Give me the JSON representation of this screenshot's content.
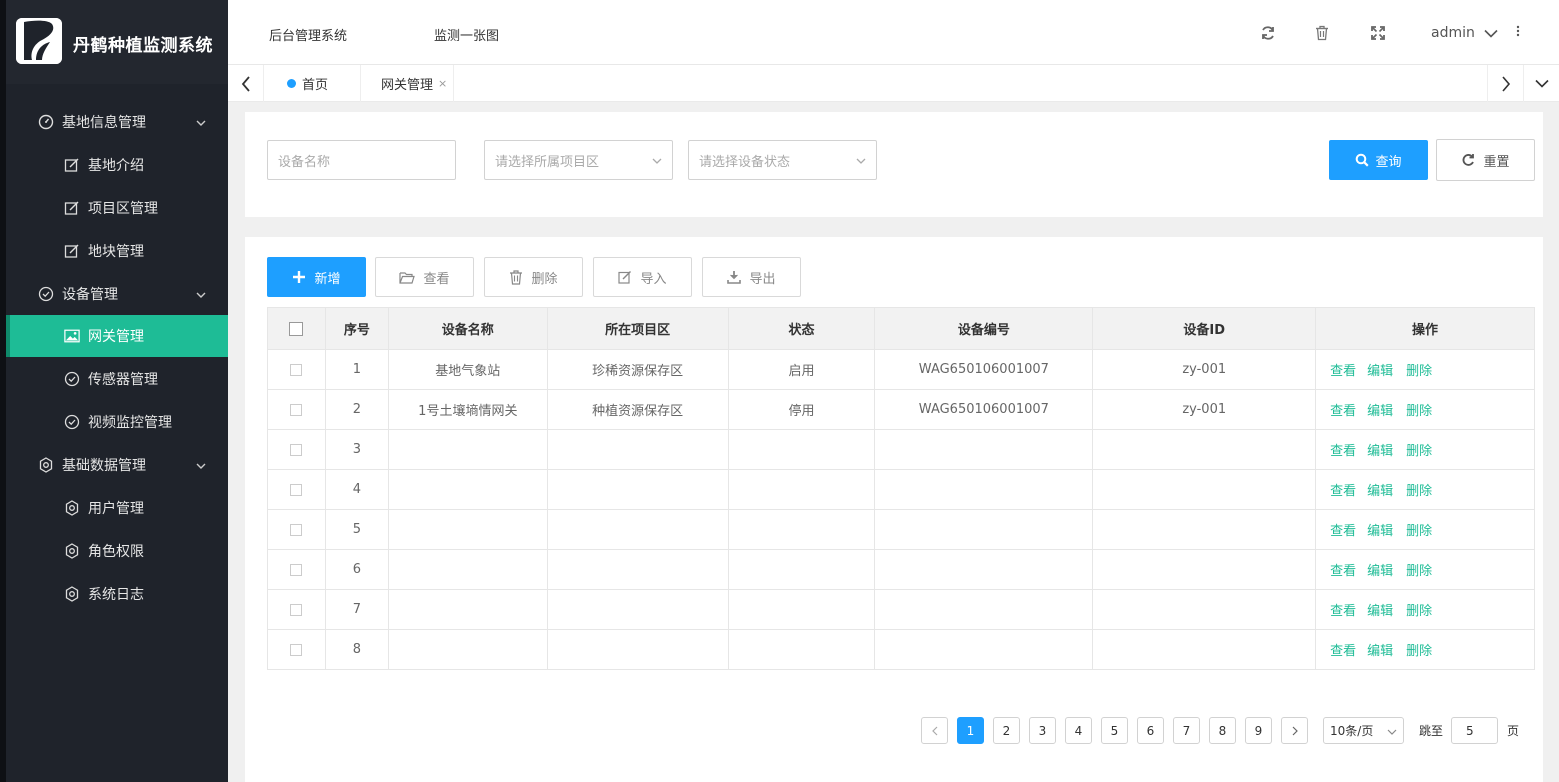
{
  "brand": {
    "title": "丹鹤种植监测系统"
  },
  "header": {
    "links": [
      "后台管理系统",
      "监测一张图"
    ],
    "user": "admin"
  },
  "tabs": {
    "home": "首页",
    "current": "网关管理",
    "close": "×"
  },
  "sidebar": {
    "groups": [
      {
        "label": "基地信息管理",
        "icon": "gauge-icon",
        "children": [
          "基地介绍",
          "项目区管理",
          "地块管理"
        ]
      },
      {
        "label": "设备管理",
        "icon": "check-circle-icon",
        "children": [
          "网关管理",
          "传感器管理",
          "视频监控管理"
        ]
      },
      {
        "label": "基础数据管理",
        "icon": "gear-icon",
        "children": [
          "用户管理",
          "角色权限",
          "系统日志"
        ]
      }
    ],
    "active": "网关管理"
  },
  "filter": {
    "device_name_placeholder": "设备名称",
    "project_area_placeholder": "请选择所属项目区",
    "status_placeholder": "请选择设备状态",
    "search_label": "查询",
    "reset_label": "重置"
  },
  "toolbar": {
    "add": "新增",
    "view": "查看",
    "delete": "删除",
    "import": "导入",
    "export": "导出"
  },
  "table": {
    "columns": [
      "序号",
      "设备名称",
      "所在项目区",
      "状态",
      "设备编号",
      "设备ID",
      "操作"
    ],
    "rows": [
      {
        "no": "1",
        "name": "基地气象站",
        "area": "珍稀资源保存区",
        "status": "启用",
        "code": "WAG650106001007",
        "id": "zy-001"
      },
      {
        "no": "2",
        "name": "1号土壤墒情网关",
        "area": "种植资源保存区",
        "status": "停用",
        "code": "WAG650106001007",
        "id": "zy-001"
      },
      {
        "no": "3",
        "name": "",
        "area": "",
        "status": "",
        "code": "",
        "id": ""
      },
      {
        "no": "4",
        "name": "",
        "area": "",
        "status": "",
        "code": "",
        "id": ""
      },
      {
        "no": "5",
        "name": "",
        "area": "",
        "status": "",
        "code": "",
        "id": ""
      },
      {
        "no": "6",
        "name": "",
        "area": "",
        "status": "",
        "code": "",
        "id": ""
      },
      {
        "no": "7",
        "name": "",
        "area": "",
        "status": "",
        "code": "",
        "id": ""
      },
      {
        "no": "8",
        "name": "",
        "area": "",
        "status": "",
        "code": "",
        "id": ""
      }
    ],
    "actions": [
      "查看",
      "编辑",
      "删除"
    ]
  },
  "pagination": {
    "pages": [
      "1",
      "2",
      "3",
      "4",
      "5",
      "6",
      "7",
      "8",
      "9"
    ],
    "current": "1",
    "page_size": "10条/页",
    "jump_label": "跳至",
    "jump_value": "5",
    "page_unit": "页"
  },
  "colors": {
    "sidebar": "#1f232b",
    "accent": "#1ebc96",
    "primary": "#1e9fff"
  }
}
